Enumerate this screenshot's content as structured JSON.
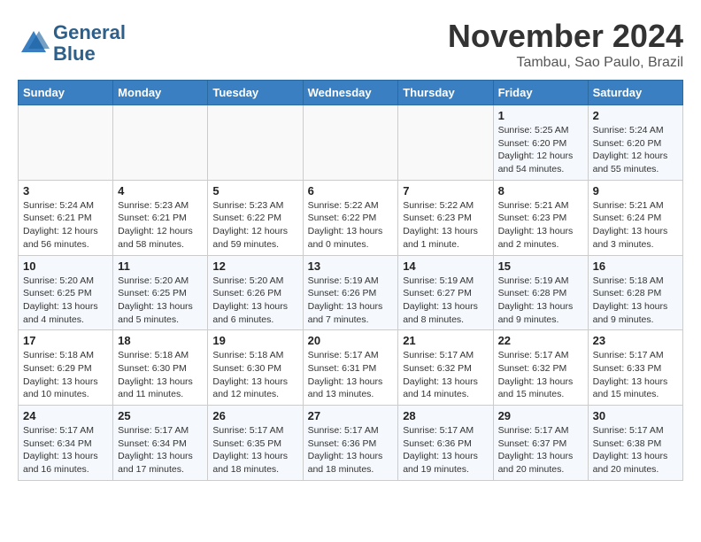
{
  "logo": {
    "line1": "General",
    "line2": "Blue"
  },
  "title": "November 2024",
  "location": "Tambau, Sao Paulo, Brazil",
  "weekdays": [
    "Sunday",
    "Monday",
    "Tuesday",
    "Wednesday",
    "Thursday",
    "Friday",
    "Saturday"
  ],
  "weeks": [
    [
      {
        "day": "",
        "info": ""
      },
      {
        "day": "",
        "info": ""
      },
      {
        "day": "",
        "info": ""
      },
      {
        "day": "",
        "info": ""
      },
      {
        "day": "",
        "info": ""
      },
      {
        "day": "1",
        "info": "Sunrise: 5:25 AM\nSunset: 6:20 PM\nDaylight: 12 hours\nand 54 minutes."
      },
      {
        "day": "2",
        "info": "Sunrise: 5:24 AM\nSunset: 6:20 PM\nDaylight: 12 hours\nand 55 minutes."
      }
    ],
    [
      {
        "day": "3",
        "info": "Sunrise: 5:24 AM\nSunset: 6:21 PM\nDaylight: 12 hours\nand 56 minutes."
      },
      {
        "day": "4",
        "info": "Sunrise: 5:23 AM\nSunset: 6:21 PM\nDaylight: 12 hours\nand 58 minutes."
      },
      {
        "day": "5",
        "info": "Sunrise: 5:23 AM\nSunset: 6:22 PM\nDaylight: 12 hours\nand 59 minutes."
      },
      {
        "day": "6",
        "info": "Sunrise: 5:22 AM\nSunset: 6:22 PM\nDaylight: 13 hours\nand 0 minutes."
      },
      {
        "day": "7",
        "info": "Sunrise: 5:22 AM\nSunset: 6:23 PM\nDaylight: 13 hours\nand 1 minute."
      },
      {
        "day": "8",
        "info": "Sunrise: 5:21 AM\nSunset: 6:23 PM\nDaylight: 13 hours\nand 2 minutes."
      },
      {
        "day": "9",
        "info": "Sunrise: 5:21 AM\nSunset: 6:24 PM\nDaylight: 13 hours\nand 3 minutes."
      }
    ],
    [
      {
        "day": "10",
        "info": "Sunrise: 5:20 AM\nSunset: 6:25 PM\nDaylight: 13 hours\nand 4 minutes."
      },
      {
        "day": "11",
        "info": "Sunrise: 5:20 AM\nSunset: 6:25 PM\nDaylight: 13 hours\nand 5 minutes."
      },
      {
        "day": "12",
        "info": "Sunrise: 5:20 AM\nSunset: 6:26 PM\nDaylight: 13 hours\nand 6 minutes."
      },
      {
        "day": "13",
        "info": "Sunrise: 5:19 AM\nSunset: 6:26 PM\nDaylight: 13 hours\nand 7 minutes."
      },
      {
        "day": "14",
        "info": "Sunrise: 5:19 AM\nSunset: 6:27 PM\nDaylight: 13 hours\nand 8 minutes."
      },
      {
        "day": "15",
        "info": "Sunrise: 5:19 AM\nSunset: 6:28 PM\nDaylight: 13 hours\nand 9 minutes."
      },
      {
        "day": "16",
        "info": "Sunrise: 5:18 AM\nSunset: 6:28 PM\nDaylight: 13 hours\nand 9 minutes."
      }
    ],
    [
      {
        "day": "17",
        "info": "Sunrise: 5:18 AM\nSunset: 6:29 PM\nDaylight: 13 hours\nand 10 minutes."
      },
      {
        "day": "18",
        "info": "Sunrise: 5:18 AM\nSunset: 6:30 PM\nDaylight: 13 hours\nand 11 minutes."
      },
      {
        "day": "19",
        "info": "Sunrise: 5:18 AM\nSunset: 6:30 PM\nDaylight: 13 hours\nand 12 minutes."
      },
      {
        "day": "20",
        "info": "Sunrise: 5:17 AM\nSunset: 6:31 PM\nDaylight: 13 hours\nand 13 minutes."
      },
      {
        "day": "21",
        "info": "Sunrise: 5:17 AM\nSunset: 6:32 PM\nDaylight: 13 hours\nand 14 minutes."
      },
      {
        "day": "22",
        "info": "Sunrise: 5:17 AM\nSunset: 6:32 PM\nDaylight: 13 hours\nand 15 minutes."
      },
      {
        "day": "23",
        "info": "Sunrise: 5:17 AM\nSunset: 6:33 PM\nDaylight: 13 hours\nand 15 minutes."
      }
    ],
    [
      {
        "day": "24",
        "info": "Sunrise: 5:17 AM\nSunset: 6:34 PM\nDaylight: 13 hours\nand 16 minutes."
      },
      {
        "day": "25",
        "info": "Sunrise: 5:17 AM\nSunset: 6:34 PM\nDaylight: 13 hours\nand 17 minutes."
      },
      {
        "day": "26",
        "info": "Sunrise: 5:17 AM\nSunset: 6:35 PM\nDaylight: 13 hours\nand 18 minutes."
      },
      {
        "day": "27",
        "info": "Sunrise: 5:17 AM\nSunset: 6:36 PM\nDaylight: 13 hours\nand 18 minutes."
      },
      {
        "day": "28",
        "info": "Sunrise: 5:17 AM\nSunset: 6:36 PM\nDaylight: 13 hours\nand 19 minutes."
      },
      {
        "day": "29",
        "info": "Sunrise: 5:17 AM\nSunset: 6:37 PM\nDaylight: 13 hours\nand 20 minutes."
      },
      {
        "day": "30",
        "info": "Sunrise: 5:17 AM\nSunset: 6:38 PM\nDaylight: 13 hours\nand 20 minutes."
      }
    ]
  ]
}
